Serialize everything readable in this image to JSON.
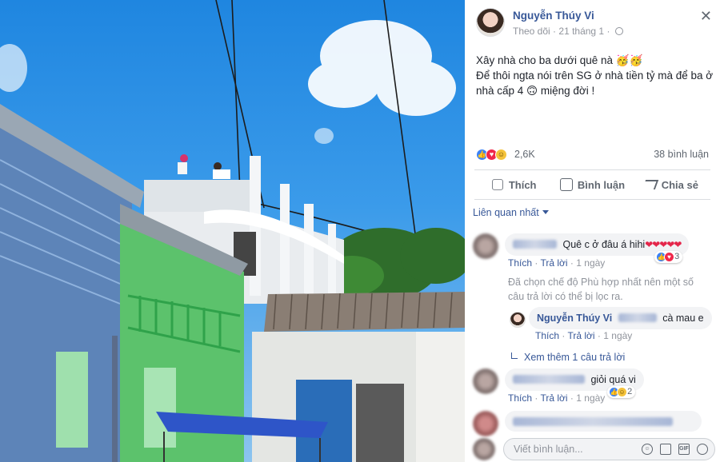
{
  "post": {
    "author": "Nguyễn Thúy Vi",
    "follow_label": "Theo dõi",
    "date": "21 tháng 1",
    "close_glyph": "✕",
    "status_lines": [
      "Xây nhà cho ba dưới quê nà 🥳🥳",
      "Để thôi ngta nói trên SG ở nhà tiền tỷ mà để ba ở",
      "nhà cấp 4 🙃 miệng đời !"
    ],
    "reaction_count": "2,6K",
    "comment_count": "38 bình luận",
    "actions": {
      "like": "Thích",
      "comment": "Bình luận",
      "share": "Chia sẻ"
    },
    "sort_label": "Liên quan nhất"
  },
  "comments": [
    {
      "text": "Quê c ở đâu á hihi",
      "hearts": "❤❤❤❤❤",
      "like": "Thích",
      "reply": "Trả lời",
      "time": "1 ngày",
      "reactions": "3"
    },
    {
      "text": "giỏi quá vi",
      "like": "Thích",
      "reply": "Trả lời",
      "time": "1 ngày",
      "reactions": "2"
    }
  ],
  "filter_note": "Đã chọn chế độ Phù hợp nhất nên một số câu trả lời có thể bị lọc ra.",
  "reply": {
    "author": "Nguyễn Thúy Vi",
    "text": "cà mau e",
    "like": "Thích",
    "reply": "Trả lời",
    "time": "1 ngày"
  },
  "more_replies": "Xem thêm 1 câu trả lời",
  "write_placeholder": "Viết bình luận...",
  "colors": {
    "link": "#385898",
    "meta": "#90949c",
    "bubble": "#f2f3f5",
    "sky": "#1f86e0"
  },
  "icons": [
    "close-icon",
    "globe-icon",
    "like-icon",
    "comment-icon",
    "share-icon",
    "emoji-icon",
    "camera-icon",
    "gif-icon",
    "sticker-icon"
  ]
}
